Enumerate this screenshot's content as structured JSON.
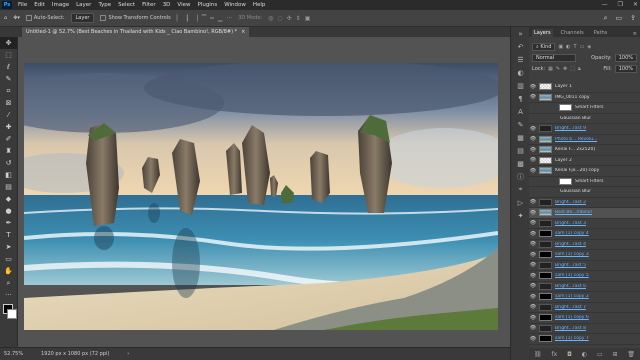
{
  "app": {
    "logo": "Ps"
  },
  "menu": [
    "File",
    "Edit",
    "Image",
    "Layer",
    "Type",
    "Select",
    "Filter",
    "3D",
    "View",
    "Plugins",
    "Window",
    "Help"
  ],
  "window_controls": [
    "—",
    "❐",
    "✕"
  ],
  "options": {
    "auto_select_label": "Auto-Select:",
    "auto_select_target": "Layer",
    "transform_label": "Show Transform Controls",
    "mode3d_label": "3D Mode:"
  },
  "document": {
    "tab_title": "Untitled-1 @ 52.7% (Best Beaches in Thailand with Kids _ Ciao Bambino!, RGB/8#) *",
    "close_glyph": "×"
  },
  "status": {
    "zoom": "52.75%",
    "dimensions": "1920 px x 1080 px (72 ppi)"
  },
  "panel": {
    "tabs": [
      "Layers",
      "Channels",
      "Paths"
    ],
    "kind_label": "Kind",
    "blend_mode": "Normal",
    "opacity_label": "Opacity:",
    "opacity_value": "100%",
    "lock_label": "Lock:",
    "fill_label": "Fill:",
    "fill_value": "100%"
  },
  "layers": [
    {
      "name": "Layer 1",
      "thumb": "checker",
      "link": false,
      "sub": false,
      "sel": false
    },
    {
      "name": "IMG_0011 copy",
      "thumb": "scene",
      "link": false,
      "sub": false,
      "sel": false
    },
    {
      "name": "Smart Filters",
      "thumb": "white",
      "link": false,
      "sub": true,
      "sel": false
    },
    {
      "name": "Gaussian Blur",
      "thumb": "none",
      "link": false,
      "sub": true,
      "sel": false
    },
    {
      "name": "Bright...rast 9",
      "thumb": "adj",
      "link": true,
      "sub": false,
      "sel": false
    },
    {
      "name": "Photo b... Revolu...",
      "thumb": "scene",
      "link": true,
      "sub": false,
      "sel": false
    },
    {
      "name": "Kenai F... 2x2520]",
      "thumb": "scene",
      "link": false,
      "sub": false,
      "sel": false
    },
    {
      "name": "Layer 2",
      "thumb": "checker",
      "link": false,
      "sub": false,
      "sel": false
    },
    {
      "name": "Kenai Fjo...20] copy",
      "thumb": "scene",
      "link": false,
      "sub": false,
      "sel": false
    },
    {
      "name": "Smart Filters",
      "thumb": "white",
      "link": false,
      "sub": true,
      "sel": false
    },
    {
      "name": "Gaussian Blur",
      "thumb": "none",
      "link": false,
      "sub": true,
      "sel": false
    },
    {
      "name": "Bright...rast 2",
      "thumb": "adj",
      "link": true,
      "sub": false,
      "sel": false
    },
    {
      "name": "Best Be...mbino!",
      "thumb": "scene",
      "link": true,
      "sub": false,
      "sel": true
    },
    {
      "name": "Bright...rast 3",
      "thumb": "adj",
      "link": true,
      "sub": false,
      "sel": false
    },
    {
      "name": "sam [1] copy 4",
      "thumb": "black",
      "link": true,
      "sub": false,
      "sel": false
    },
    {
      "name": "Bright...rast 4",
      "thumb": "adj",
      "link": true,
      "sub": false,
      "sel": false
    },
    {
      "name": "sam [1] copy 3",
      "thumb": "black",
      "link": true,
      "sub": false,
      "sel": false
    },
    {
      "name": "Bright...rast 5",
      "thumb": "adj",
      "link": true,
      "sub": false,
      "sel": false
    },
    {
      "name": "sam [1] copy 5",
      "thumb": "black",
      "link": true,
      "sub": false,
      "sel": false
    },
    {
      "name": "Bright...rast 6",
      "thumb": "adj",
      "link": true,
      "sub": false,
      "sel": false
    },
    {
      "name": "sam [1] copy 2",
      "thumb": "black",
      "link": true,
      "sub": false,
      "sel": false
    },
    {
      "name": "Bright...rast 7",
      "thumb": "adj",
      "link": true,
      "sub": false,
      "sel": false
    },
    {
      "name": "sam [1] copy 6",
      "thumb": "black",
      "link": true,
      "sub": false,
      "sel": false
    },
    {
      "name": "Bright...rast 8",
      "thumb": "adj",
      "link": true,
      "sub": false,
      "sel": false
    },
    {
      "name": "sam [1] copy 7",
      "thumb": "black",
      "link": true,
      "sub": false,
      "sel": false
    }
  ],
  "tools": [
    "move-tool",
    "artboard-tool",
    "marquee-tool",
    "lasso-tool",
    "quick-select-tool",
    "crop-tool",
    "frame-tool",
    "eyedropper-tool",
    "healing-tool",
    "brush-tool",
    "stamp-tool",
    "history-brush-tool",
    "eraser-tool",
    "gradient-tool",
    "blur-tool",
    "dodge-tool",
    "pen-tool",
    "type-tool",
    "path-select-tool",
    "rectangle-tool",
    "hand-tool",
    "zoom-tool",
    "more-tools"
  ],
  "colors": {
    "accent": "#31a8ff",
    "panel_bg": "#3f3f3f",
    "canvas_bg": "#535353"
  }
}
